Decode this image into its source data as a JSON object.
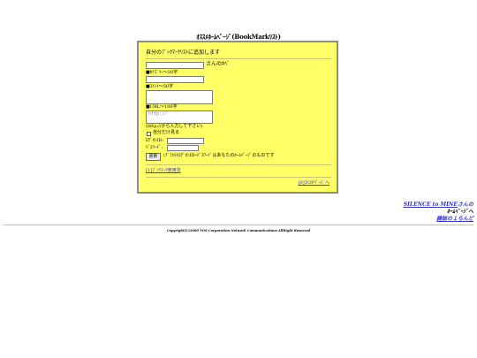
{
  "page": {
    "title": "ｵｽｽﾒﾎｰﾑﾍﾟｰｼﾞ(BookMarkﾘｽﾄ)"
  },
  "form": {
    "intro": "自分のﾌﾞｯｸﾏｰｸﾘｽﾄに追加します",
    "name_suffix": "さんのﾎﾍﾟ",
    "category_label": "■ｶﾃｺﾞﾘｰ～20字",
    "comment_label": "■ｺﾒﾝﾄ～50字",
    "url_label": "■URL～100字",
    "url_placeholder": "http://",
    "url_hint": "(http://から入力して下さい)",
    "self_only_label": "自分だけ見る",
    "login_id_label": "ﾛｸﾞｵﾝID:",
    "password_label": "ﾊﾟｽﾜｰﾄﾞ:",
    "submit_label": "更新",
    "submit_note": "(ﾃﾞﾌｫﾙﾄﾛｸﾞｵﾝIDｰﾊﾟｽﾜｰﾄﾞはあなたのﾎｰﾑﾍﾟｰｼﾞのものです",
    "usage_link": "[1]ﾌﾞｯｸﾏｰｸ使用法",
    "top_link": "[0]TOPﾍﾟｰｼﾞへ"
  },
  "right_links": {
    "line1_name": "SILENCE to MINE",
    "line1_suffix": "さんの",
    "line2": "ﾎｰﾑﾍﾟｰｼﾞへ",
    "line3": "雑誌の１らんど"
  },
  "footer": {
    "copyright": "Copyright(C)2000 TOS Corporation Network Communications AllRight Reserved"
  }
}
